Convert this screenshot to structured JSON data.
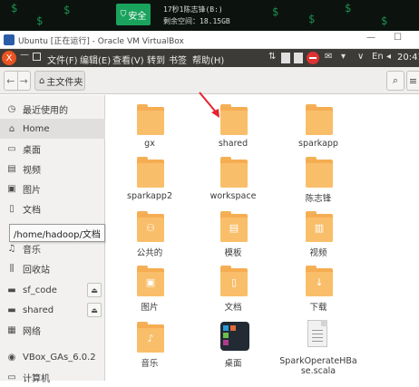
{
  "banner": {
    "safe_label": "安全",
    "line1": "17秒1陈志锋(B:)",
    "line2": "剩余空间：18.15GB"
  },
  "vbox": {
    "title": "Ubuntu [正在运行] - Oracle VM VirtualBox",
    "min": "—",
    "max": "☐"
  },
  "panel": {
    "close": "X",
    "menus": [
      "文件(F)",
      "编辑(E)",
      "查看(V)",
      "转到",
      "书签",
      "帮助(H)"
    ],
    "lang": "En",
    "clock": "20:41"
  },
  "toolbar": {
    "back": "←",
    "forward": "→",
    "path_label": "主文件夹",
    "search_icon": "⌕",
    "menu_icon": "≡"
  },
  "sidebar": {
    "items": [
      {
        "label": "最近使用的",
        "icon": "clock-icon"
      },
      {
        "label": "Home",
        "icon": "home-icon"
      },
      {
        "label": "桌面",
        "icon": "desktop-icon"
      },
      {
        "label": "视频",
        "icon": "video-icon"
      },
      {
        "label": "图片",
        "icon": "picture-icon"
      },
      {
        "label": "文档",
        "icon": "document-icon"
      },
      {
        "label": "下载",
        "icon": "download-icon"
      },
      {
        "label": "音乐",
        "icon": "music-icon"
      },
      {
        "label": "回收站",
        "icon": "trash-icon"
      },
      {
        "label": "sf_code",
        "icon": "drive-icon"
      },
      {
        "label": "shared",
        "icon": "drive-icon"
      },
      {
        "label": "网络",
        "icon": "network-icon"
      },
      {
        "label": "VBox_GAs_6.0.2",
        "icon": "disc-icon"
      },
      {
        "label": "计算机",
        "icon": "computer-icon"
      }
    ],
    "tooltip": "/home/hadoop/文档"
  },
  "files": [
    {
      "label": "gx",
      "type": "folder"
    },
    {
      "label": "shared",
      "type": "folder"
    },
    {
      "label": "sparkapp",
      "type": "folder"
    },
    {
      "label": "sparkapp2",
      "type": "folder"
    },
    {
      "label": "workspace",
      "type": "folder"
    },
    {
      "label": "陈志锋",
      "type": "folder"
    },
    {
      "label": "公共的",
      "type": "folder-public"
    },
    {
      "label": "模板",
      "type": "folder-templates"
    },
    {
      "label": "视频",
      "type": "folder-videos"
    },
    {
      "label": "图片",
      "type": "folder-pictures"
    },
    {
      "label": "文档",
      "type": "folder-documents"
    },
    {
      "label": "下载",
      "type": "folder-downloads"
    },
    {
      "label": "音乐",
      "type": "folder-music"
    },
    {
      "label": "桌面",
      "type": "desktop-launcher"
    },
    {
      "label": "SparkOperateHBase.scala",
      "type": "scala-file"
    }
  ],
  "colors": {
    "folder": "#f6ad52",
    "ubuntu_orange": "#e95420",
    "panel_bg": "#3c3b37",
    "annotation_arrow": "#e5222f"
  }
}
